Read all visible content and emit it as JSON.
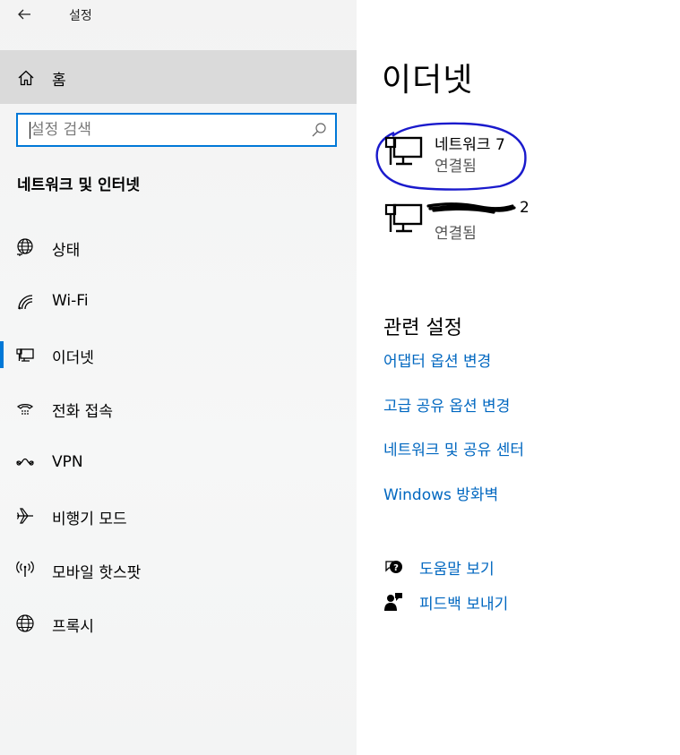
{
  "window": {
    "title": "설정"
  },
  "sidebar": {
    "home_label": "홈",
    "search_placeholder": "설정 검색",
    "section_title": "네트워크 및 인터넷",
    "items": [
      {
        "label": "상태",
        "icon": "globe-status-icon"
      },
      {
        "label": "Wi-Fi",
        "icon": "wifi-icon"
      },
      {
        "label": "이더넷",
        "icon": "ethernet-icon",
        "selected": true
      },
      {
        "label": "전화 접속",
        "icon": "dialup-icon"
      },
      {
        "label": "VPN",
        "icon": "vpn-icon"
      },
      {
        "label": "비행기 모드",
        "icon": "airplane-icon"
      },
      {
        "label": "모바일 핫스팟",
        "icon": "hotspot-icon"
      },
      {
        "label": "프록시",
        "icon": "globe-icon"
      }
    ]
  },
  "main": {
    "title": "이더넷",
    "adapters": [
      {
        "name": "네트워크 7",
        "status": "연결됨",
        "annotated": true
      },
      {
        "name": "2",
        "status": "연결됨",
        "redacted": true
      }
    ],
    "related": {
      "title": "관련 설정",
      "links": [
        "어댑터 옵션 변경",
        "고급 공유 옵션 변경",
        "네트워크 및 공유 센터",
        "Windows 방화벽"
      ]
    },
    "help": {
      "get_help": "도움말 보기",
      "feedback": "피드백 보내기"
    }
  },
  "colors": {
    "accent": "#0078d7",
    "link": "#0067c0",
    "annotation": "#1a1acc"
  }
}
